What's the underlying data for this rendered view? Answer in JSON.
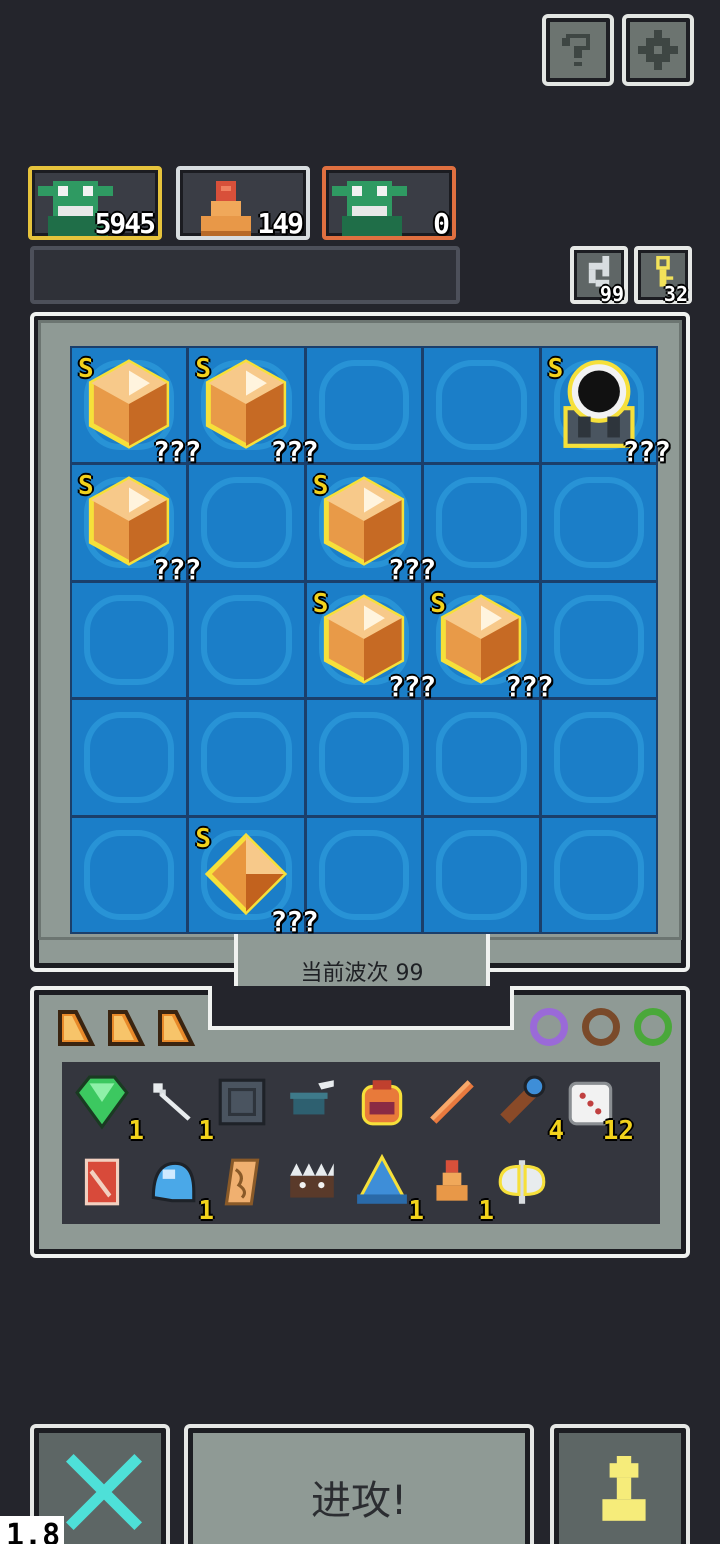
{
  "top_buttons": {
    "help_icon": "question-icon",
    "settings_icon": "gear-icon"
  },
  "players": [
    {
      "score": "5945",
      "border": "#e6c33c",
      "avatar": "goblin-icon"
    },
    {
      "score": "149",
      "border": "#d8dde0",
      "avatar": "pawn-icon"
    },
    {
      "score": "0",
      "border": "#e07040",
      "avatar": "goblin-icon"
    }
  ],
  "counters": {
    "refresh": "99",
    "key": "32"
  },
  "board": {
    "cells": [
      {
        "row": 0,
        "col": 0,
        "type": "crystal",
        "rank": "S",
        "qty": "???"
      },
      {
        "row": 0,
        "col": 1,
        "type": "crystal",
        "rank": "S",
        "qty": "???"
      },
      {
        "row": 0,
        "col": 4,
        "type": "blackhole",
        "rank": "S",
        "qty": "???"
      },
      {
        "row": 1,
        "col": 0,
        "type": "crystal",
        "rank": "S",
        "qty": "???"
      },
      {
        "row": 1,
        "col": 2,
        "type": "crystal",
        "rank": "S",
        "qty": "???"
      },
      {
        "row": 2,
        "col": 2,
        "type": "crystal",
        "rank": "S",
        "qty": "???"
      },
      {
        "row": 2,
        "col": 3,
        "type": "crystal",
        "rank": "S",
        "qty": "???"
      },
      {
        "row": 4,
        "col": 1,
        "type": "gem",
        "rank": "S",
        "qty": "???"
      }
    ]
  },
  "wave": {
    "label": "当前波次 99"
  },
  "inventory": {
    "row1": [
      {
        "icon": "emerald-icon",
        "count": "1"
      },
      {
        "icon": "bone-icon",
        "count": "1"
      },
      {
        "icon": "rune-stone-icon",
        "count": ""
      },
      {
        "icon": "mortar-icon",
        "count": ""
      },
      {
        "icon": "backpack-icon",
        "count": ""
      },
      {
        "icon": "stick-icon",
        "count": ""
      },
      {
        "icon": "telescope-icon",
        "count": "4"
      },
      {
        "icon": "dice-icon",
        "count": "12"
      }
    ],
    "row2": [
      {
        "icon": "banner-icon",
        "count": ""
      },
      {
        "icon": "helmet-icon",
        "count": "1"
      },
      {
        "icon": "scroll-icon",
        "count": ""
      },
      {
        "icon": "spike-trap-icon",
        "count": ""
      },
      {
        "icon": "wizard-hat-icon",
        "count": "1"
      },
      {
        "icon": "pawn-icon",
        "count": "1"
      },
      {
        "icon": "double-axe-icon",
        "count": ""
      }
    ]
  },
  "attack_button": {
    "label": "进攻!"
  },
  "speed_label": "1.8"
}
